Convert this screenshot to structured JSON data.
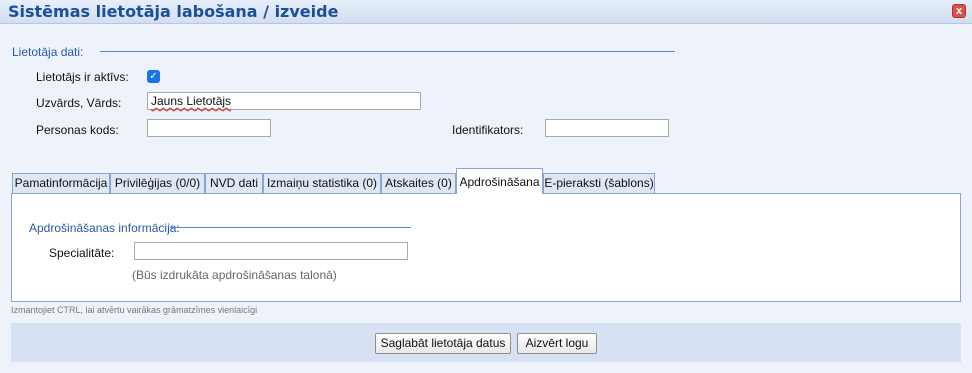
{
  "window": {
    "title": "Sistēmas lietotāja labošana / izveide",
    "close_glyph": "x"
  },
  "user_section": {
    "legend": "Lietotāja dati:",
    "active_label": "Lietotājs ir aktīvs:",
    "active_checked": true,
    "name_label": "Uzvārds, Vārds:",
    "name_value": "Jauns Lietotājs",
    "personal_code_label": "Personas kods:",
    "personal_code_value": "",
    "identifier_label": "Identifikators:",
    "identifier_value": ""
  },
  "tabs": [
    {
      "label": "Pamatinformācija",
      "active": false
    },
    {
      "label": "Privilēģijas (0/0)",
      "active": false
    },
    {
      "label": "NVD dati",
      "active": false
    },
    {
      "label": "Izmaiņu statistika (0)",
      "active": false
    },
    {
      "label": "Atskaites (0)",
      "active": false
    },
    {
      "label": "Apdrošināšana",
      "active": true
    },
    {
      "label": "E-pieraksti (šablons)",
      "active": false
    }
  ],
  "insurance": {
    "legend": "Apdrošināšanas informācija:",
    "specialty_label": "Specialitāte:",
    "specialty_value": "",
    "hint": "(Būs izdrukāta apdrošināšanas talonā)"
  },
  "footer_note": "Izmantojiet CTRL, lai atvērtu vairākas grāmatzīmes vienlaicīgi",
  "buttons": {
    "save": "Saglabāt lietotāja datus",
    "close": "Aizvērt logu"
  }
}
